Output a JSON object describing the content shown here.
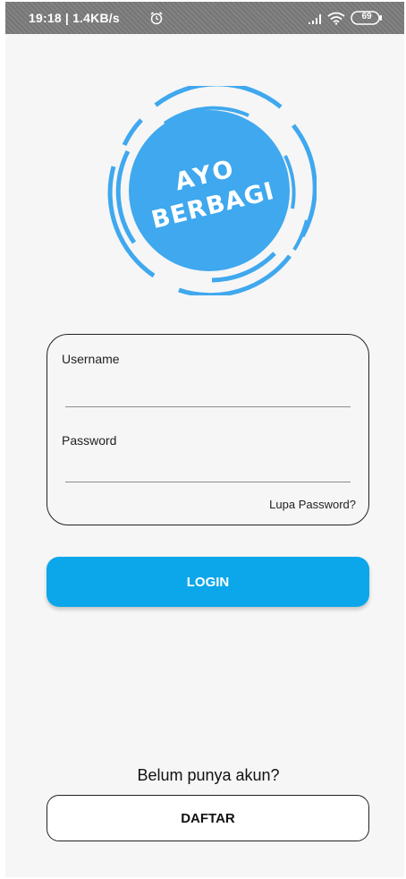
{
  "status_bar": {
    "time_speed": "19:18 | 1.4KB/s",
    "battery_level": "69",
    "icons": [
      "alarm-icon",
      "signal-icon",
      "wifi-icon",
      "battery-icon"
    ]
  },
  "logo": {
    "line1": "AYO",
    "line2": "BERBAGI",
    "color": "#3fa8ee"
  },
  "login_form": {
    "username_label": "Username",
    "username_value": "",
    "password_label": "Password",
    "password_value": "",
    "forgot_password": "Lupa Password?"
  },
  "login_button": "LOGIN",
  "register_prompt": "Belum punya akun?",
  "register_button": "DAFTAR",
  "colors": {
    "accent": "#0ba7ea",
    "background": "#f6f6f6",
    "status_bar": "#7c7c7c"
  }
}
